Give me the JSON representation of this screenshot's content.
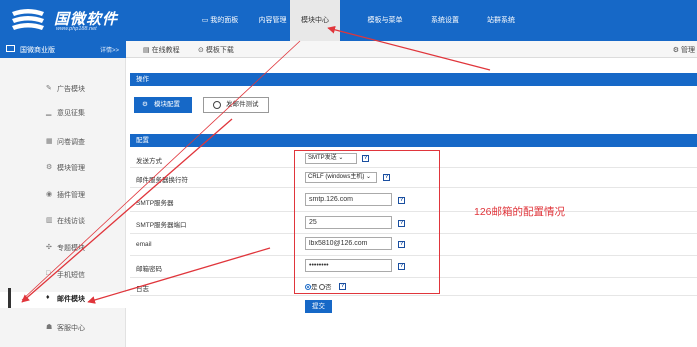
{
  "logo": {
    "title": "国微软件",
    "url": "www.php188.net"
  },
  "nav": [
    {
      "label": "我的面板",
      "icon": "monitor-icon"
    },
    {
      "label": "内容管理"
    },
    {
      "label": "模块中心",
      "active": true
    },
    {
      "label": "模板与菜单"
    },
    {
      "label": "系统设置"
    },
    {
      "label": "站群系统"
    }
  ],
  "subbar": {
    "title": "国微商业版",
    "detail": "详情>>",
    "links": [
      "在线教程",
      "模板下载"
    ],
    "right": "管理"
  },
  "sidebar": {
    "items": [
      {
        "icon": "✎",
        "label": "广告模块"
      },
      {
        "icon": "▁",
        "label": "意见征集"
      },
      {
        "icon": "▦",
        "label": "问卷调查"
      },
      {
        "icon": "⚙",
        "label": "模块管理"
      },
      {
        "icon": "◉",
        "label": "插件管理"
      },
      {
        "icon": "▥",
        "label": "在线访谈"
      },
      {
        "icon": "✣",
        "label": "专题模块"
      },
      {
        "icon": "□",
        "label": "手机短信"
      },
      {
        "icon": "♦",
        "label": "邮件模块",
        "active": true
      },
      {
        "icon": "☗",
        "label": "客服中心"
      }
    ]
  },
  "ops": {
    "head": "操作",
    "config_button": "模块配置",
    "test_button": "发邮件测试"
  },
  "config": {
    "head": "配置",
    "rows": [
      {
        "label": "发送方式",
        "type": "select",
        "value": "SMTP发送"
      },
      {
        "label": "邮件服务器换行符",
        "type": "select",
        "value": "CRLF (windows主机)"
      },
      {
        "label": "SMTP服务器",
        "type": "text",
        "value": "smtp.126.com"
      },
      {
        "label": "SMTP服务器端口",
        "type": "text",
        "value": "25"
      },
      {
        "label": "email",
        "type": "text",
        "value": "lbx5810@126.com"
      },
      {
        "label": "邮箱密码",
        "type": "password",
        "value": "••••••••"
      },
      {
        "label": "日志",
        "type": "radio",
        "options": [
          "是",
          "否"
        ],
        "selected": "是"
      }
    ],
    "help_glyph": "?",
    "submit": "提交"
  },
  "annotation": "126邮箱的配置情况",
  "colors": {
    "primary": "#1668c7",
    "annotation": "#e0353b"
  }
}
